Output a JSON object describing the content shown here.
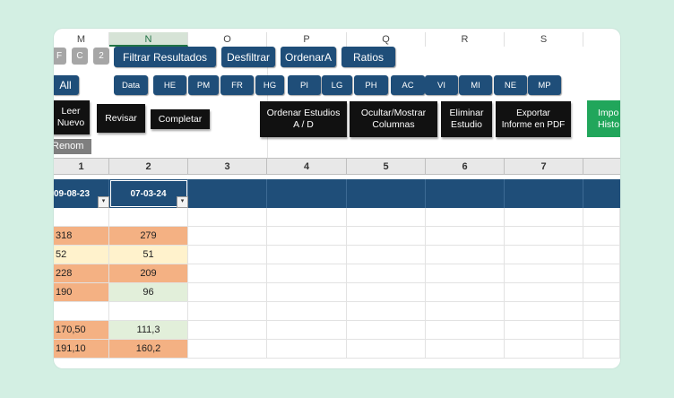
{
  "columns": [
    "M",
    "N",
    "O",
    "P",
    "Q",
    "R",
    "S"
  ],
  "toolbar_row1": {
    "small_buttons": [
      "F",
      "C",
      "2"
    ],
    "filter": "Filtrar Resultados",
    "unfilter": "Desfiltrar",
    "sort": "OrdenarA",
    "ratios": "Ratios"
  },
  "toolbar_row2": {
    "all": "All",
    "tags": [
      "Data",
      "HE",
      "PM",
      "FR",
      "HG",
      "PI",
      "LG",
      "PH",
      "AC",
      "VI",
      "MI",
      "NE",
      "MP"
    ]
  },
  "actions": {
    "leer": "Leer\nNuevo",
    "revisar": "Revisar",
    "completar": "Completar",
    "ordenar": "Ordenar Estudios\nA / D",
    "ocultar": "Ocultar/Mostrar\nColumnas",
    "eliminar": "Eliminar\nEstudio",
    "exportar": "Exportar\nInforme en PDF",
    "importar": "Impo\nHisto"
  },
  "renom": "Renom",
  "study_numbers": [
    "1",
    "2",
    "3",
    "4",
    "5",
    "6",
    "7"
  ],
  "dates": [
    "09-08-23",
    "07-03-24"
  ],
  "rows": [
    {
      "c1": "318",
      "c2": "279",
      "color1": "#f4b183",
      "color2": "#f4b183"
    },
    {
      "c1": "52",
      "c2": "51",
      "color1": "#fff2cc",
      "color2": "#fff2cc"
    },
    {
      "c1": "228",
      "c2": "209",
      "color1": "#f4b183",
      "color2": "#f4b183"
    },
    {
      "c1": "190",
      "c2": "96",
      "color1": "#f4b183",
      "color2": "#e2efda"
    },
    {
      "c1": "",
      "c2": "",
      "color1": "#ffffff",
      "color2": "#ffffff"
    },
    {
      "c1": "170,50",
      "c2": "111,3",
      "color1": "#f4b183",
      "color2": "#e2efda"
    },
    {
      "c1": "191,10",
      "c2": "160,2",
      "color1": "#f4b183",
      "color2": "#f4b183"
    }
  ],
  "colors": {
    "accent_blue": "#1f4e79",
    "header_gray": "#e8e8e8",
    "green": "#21a65b"
  }
}
